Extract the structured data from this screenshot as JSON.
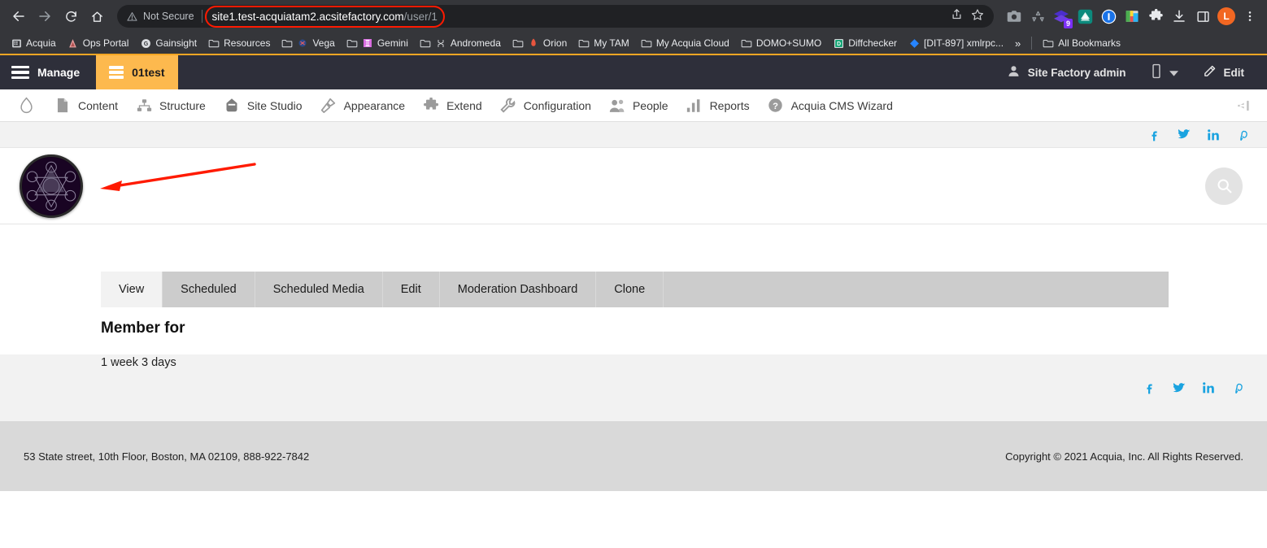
{
  "browser": {
    "nav": {
      "back": "back-arrow",
      "forward": "forward-arrow",
      "reload": "reload",
      "home": "home"
    },
    "security_label": "Not Secure",
    "url_main": "site1.test-acquiatam2.acsitefactory.com",
    "url_path": "/user/1",
    "omnibox_actions": [
      "share-icon",
      "bookmark-star-icon"
    ],
    "extensions": [
      {
        "name": "camera-icon",
        "badge": ""
      },
      {
        "name": "recycle-icon",
        "badge": ""
      },
      {
        "name": "layers-purple-icon",
        "badge": "9"
      },
      {
        "name": "evernote-icon",
        "badge": ""
      },
      {
        "name": "onepassword-icon",
        "badge": ""
      },
      {
        "name": "colorpicker-icon",
        "badge": ""
      },
      {
        "name": "puzzle-extensions-icon",
        "badge": ""
      },
      {
        "name": "download-icon",
        "badge": ""
      },
      {
        "name": "sidepanel-icon",
        "badge": ""
      }
    ],
    "profile_initial": "L",
    "menu_icon": "kebab-menu-icon"
  },
  "bookmarks": {
    "items": [
      {
        "label": "Acquia",
        "icon": "acquia-icon"
      },
      {
        "label": "Ops Portal",
        "icon": "ops-portal-icon"
      },
      {
        "label": "Gainsight",
        "icon": "gainsight-icon"
      },
      {
        "label": "Resources",
        "icon": "folder-icon"
      },
      {
        "label": "Vega",
        "icon": "folder-icon"
      },
      {
        "label": "Gemini",
        "icon": "folder-icon"
      },
      {
        "label": "Andromeda",
        "icon": "folder-icon"
      },
      {
        "label": "Orion",
        "icon": "folder-icon"
      },
      {
        "label": "My TAM",
        "icon": "folder-icon"
      },
      {
        "label": "My Acquia Cloud",
        "icon": "folder-icon"
      },
      {
        "label": "DOMO+SUMO",
        "icon": "folder-icon"
      },
      {
        "label": "Diffchecker",
        "icon": "diffchecker-icon"
      },
      {
        "label": "[DIT-897] xmlrpc...",
        "icon": "jira-icon"
      }
    ],
    "overflow": "»",
    "all_bookmarks": "All Bookmarks"
  },
  "drupal_toolbar": {
    "manage": "Manage",
    "site": "01test",
    "user": "Site Factory admin",
    "edit": "Edit",
    "device_icon": "mobile-preview-icon",
    "pencil_icon": "pencil-icon"
  },
  "admin_menu": {
    "items": [
      {
        "label": "Content",
        "icon": "content-page-icon"
      },
      {
        "label": "Structure",
        "icon": "structure-tree-icon"
      },
      {
        "label": "Site Studio",
        "icon": "site-studio-icon"
      },
      {
        "label": "Appearance",
        "icon": "appearance-brush-icon"
      },
      {
        "label": "Extend",
        "icon": "extend-puzzle-icon"
      },
      {
        "label": "Configuration",
        "icon": "configuration-wrench-icon"
      },
      {
        "label": "People",
        "icon": "people-icon"
      },
      {
        "label": "Reports",
        "icon": "reports-bars-icon"
      },
      {
        "label": "Acquia CMS Wizard",
        "icon": "question-help-icon"
      }
    ],
    "drupal_logo": "drupal-drop-icon",
    "collapse": "collapse-sidebar-icon"
  },
  "site": {
    "logo_alt": "site-logo",
    "search": "search-icon",
    "social": [
      {
        "name": "facebook-icon",
        "glyph": "f"
      },
      {
        "name": "twitter-icon",
        "glyph": ""
      },
      {
        "name": "linkedin-icon",
        "glyph": "in"
      },
      {
        "name": "pinterest-icon",
        "glyph": "P"
      }
    ]
  },
  "annotation": {
    "arrow": "red-annotation-arrow",
    "color": "#ff1a00"
  },
  "content": {
    "tabs": [
      {
        "label": "View",
        "active": true
      },
      {
        "label": "Scheduled",
        "active": false
      },
      {
        "label": "Scheduled Media",
        "active": false
      },
      {
        "label": "Edit",
        "active": false
      },
      {
        "label": "Moderation Dashboard",
        "active": false
      },
      {
        "label": "Clone",
        "active": false
      }
    ],
    "heading": "Member for",
    "value": "1 week 3 days"
  },
  "footer": {
    "address": "53 State street, 10th Floor, Boston, MA 02109, 888-922-7842",
    "copyright": "Copyright © 2021 Acquia, Inc. All Rights Reserved."
  },
  "colors": {
    "chrome_bg": "#35363a",
    "omnibox_bg": "#202124",
    "accent_orange": "#fdb94e",
    "toolbar_dark": "#2e2f3a",
    "social_blue": "#1aa3e0",
    "annotation_red": "#ff1a00"
  }
}
